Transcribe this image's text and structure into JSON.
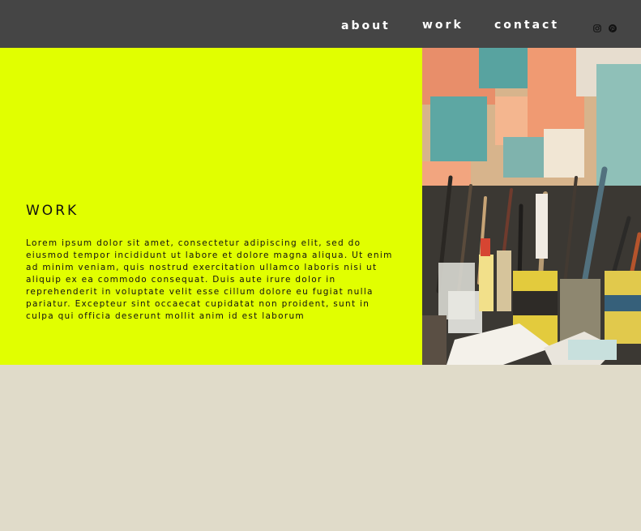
{
  "nav": {
    "items": [
      {
        "label": "about"
      },
      {
        "label": "work"
      },
      {
        "label": "contact"
      }
    ]
  },
  "social": {
    "icons": [
      "instagram-icon",
      "pinterest-icon"
    ]
  },
  "hero": {
    "title": "WORK",
    "body": "Lorem ipsum dolor sit amet, consectetur adipiscing elit, sed do eiusmod tempor incididunt ut labore et dolore magna aliqua. Ut enim ad minim veniam, quis nostrud exercitation ullamco laboris nisi ut aliquip ex ea commodo consequat. Duis aute irure dolor in reprehenderit in voluptate velit esse cillum dolore eu fugiat nulla pariatur. Excepteur sint occaecat cupidatat non proident, sunt in culpa qui officia deserunt mollit anim id est laborum"
  },
  "colors": {
    "header": "#454545",
    "accent": "#e1ff00",
    "page_background": "#e0dbc9"
  }
}
